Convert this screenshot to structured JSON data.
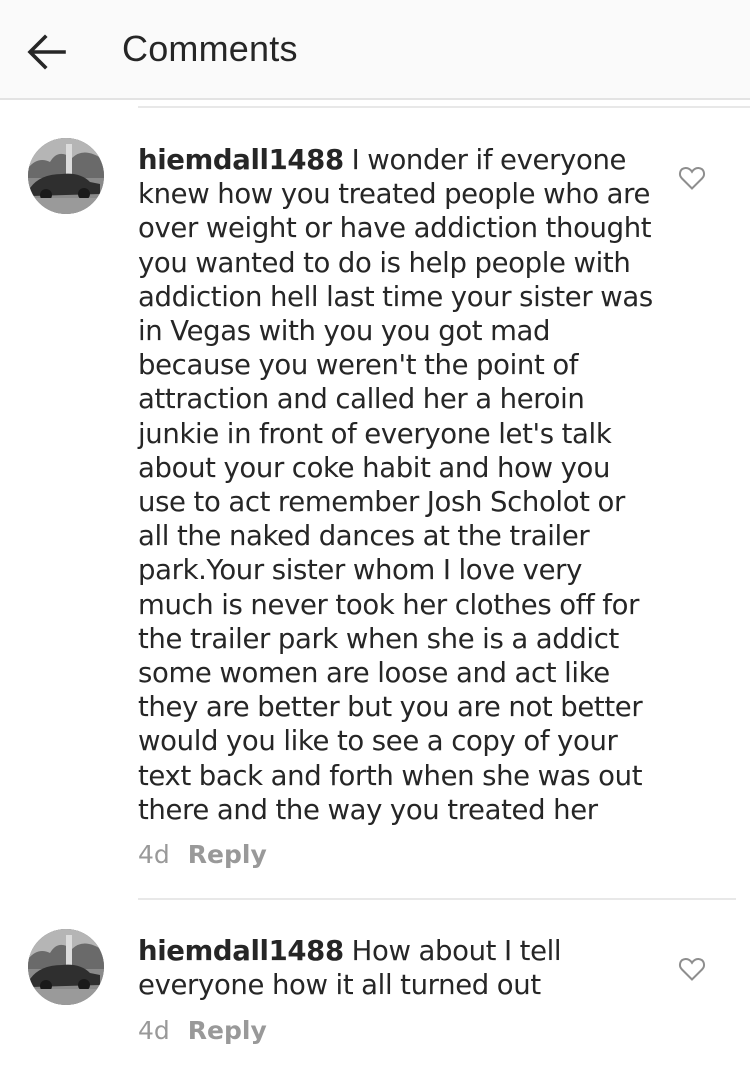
{
  "header": {
    "title": "Comments",
    "back_icon": "arrow-left-icon"
  },
  "comments": [
    {
      "username": "hiemdall1488",
      "text": "I wonder if everyone knew how you treated people who are over weight or have addiction thought you wanted to do is help people with addiction hell last time your sister was in Vegas with you you got mad because you weren't the point of attraction and called her a heroin junkie in front of everyone let's talk about your coke habit and how you use to act remember Josh Scholot or all the naked dances at the trailer park.Your sister whom I love very much is never took her clothes off for the trailer park when she is a addict some women are loose and act like they are better but you are not better would you like to see a copy of your text back and forth when she was out there and the way you treated her",
      "time": "4d",
      "reply_label": "Reply",
      "like_icon": "heart-outline-icon"
    },
    {
      "username": "hiemdall1488",
      "text": "How about I tell everyone how it all turned out",
      "time": "4d",
      "reply_label": "Reply",
      "like_icon": "heart-outline-icon"
    }
  ],
  "colors": {
    "text": "#262626",
    "meta": "#999999",
    "header_bg": "#fafafa",
    "divider": "#e3e3e3"
  }
}
